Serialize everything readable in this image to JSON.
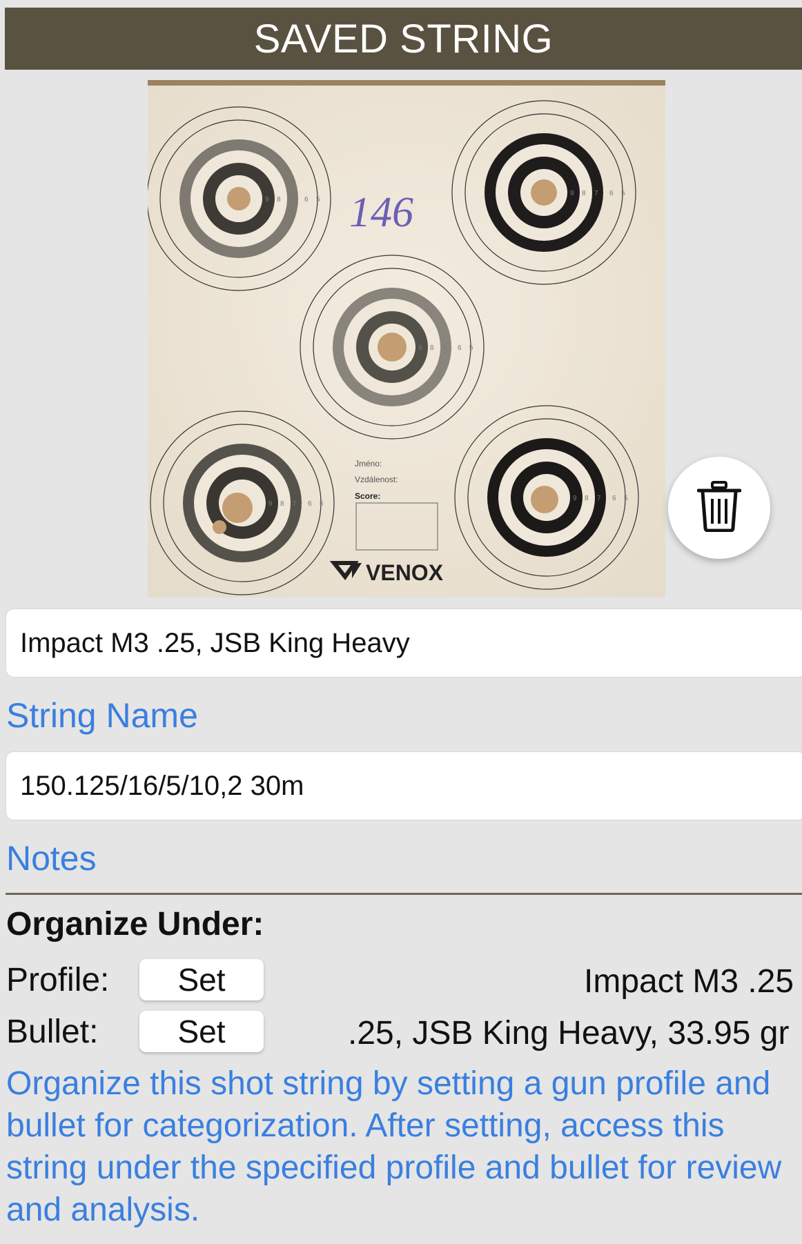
{
  "header": {
    "title": "SAVED STRING"
  },
  "photo": {
    "handwritten_score": "146",
    "card_label_name": "Jméno:",
    "card_label_distance": "Vzdálenost:",
    "card_label_score": "Score:",
    "brand": "VENOX",
    "ring_numbers": [
      "9",
      "8",
      "7",
      "6",
      "5"
    ]
  },
  "actions": {
    "delete_icon": "trash-icon"
  },
  "string_name": {
    "value": "Impact M3 .25, JSB King Heavy",
    "label": "String Name"
  },
  "notes": {
    "value": "150.125/16/5/10,2 30m",
    "label": "Notes"
  },
  "organize": {
    "title": "Organize Under:",
    "profile": {
      "label": "Profile:",
      "button": "Set",
      "value": "Impact M3 .25"
    },
    "bullet": {
      "label": "Bullet:",
      "button": "Set",
      "value": ".25, JSB King Heavy, 33.95 gr"
    },
    "help": "Organize this shot string by setting a gun profile and bullet for categorization. After setting, access this string under the specified profile and bullet for review and analysis."
  },
  "colors": {
    "header_bg": "#5a5240",
    "accent": "#3a7fe0",
    "background": "#e5e5e5"
  }
}
